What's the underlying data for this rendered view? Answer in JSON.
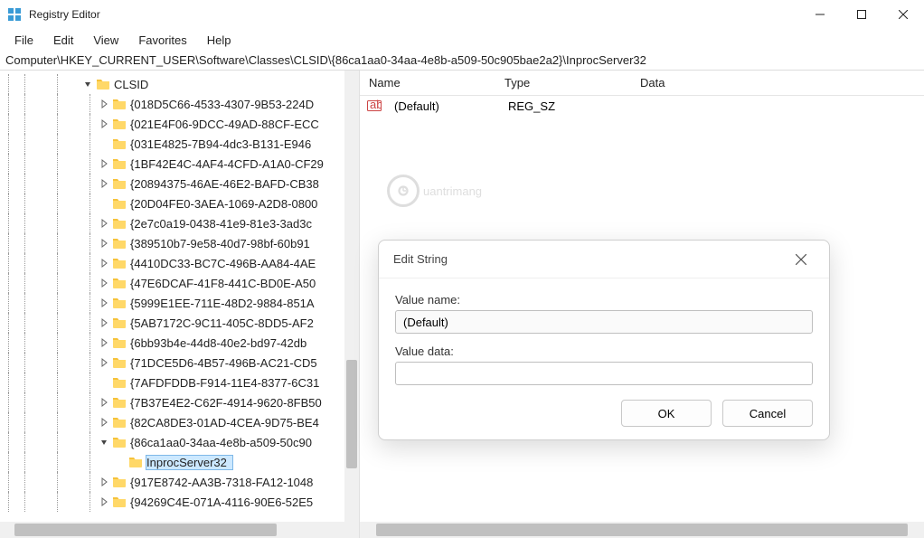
{
  "window": {
    "title": "Registry Editor"
  },
  "menu": {
    "file": "File",
    "edit": "Edit",
    "view": "View",
    "favorites": "Favorites",
    "help": "Help"
  },
  "addressbar": "Computer\\HKEY_CURRENT_USER\\Software\\Classes\\CLSID\\{86ca1aa0-34aa-4e8b-a509-50c905bae2a2}\\InprocServer32",
  "columns": {
    "name": "Name",
    "type": "Type",
    "data": "Data"
  },
  "values": [
    {
      "name": "(Default)",
      "type": "REG_SZ",
      "data": ""
    }
  ],
  "watermark": "uantrimang",
  "tree": {
    "root": "CLSID",
    "items": [
      {
        "label": "{018D5C66-4533-4307-9B53-224D",
        "exp": "closed"
      },
      {
        "label": "{021E4F06-9DCC-49AD-88CF-ECC",
        "exp": "closed"
      },
      {
        "label": "{031E4825-7B94-4dc3-B131-E946",
        "exp": "none"
      },
      {
        "label": "{1BF42E4C-4AF4-4CFD-A1A0-CF29",
        "exp": "closed"
      },
      {
        "label": "{20894375-46AE-46E2-BAFD-CB38",
        "exp": "closed"
      },
      {
        "label": "{20D04FE0-3AEA-1069-A2D8-0800",
        "exp": "none"
      },
      {
        "label": "{2e7c0a19-0438-41e9-81e3-3ad3c",
        "exp": "closed"
      },
      {
        "label": "{389510b7-9e58-40d7-98bf-60b91",
        "exp": "closed"
      },
      {
        "label": "{4410DC33-BC7C-496B-AA84-4AE",
        "exp": "closed"
      },
      {
        "label": "{47E6DCAF-41F8-441C-BD0E-A50",
        "exp": "closed"
      },
      {
        "label": "{5999E1EE-711E-48D2-9884-851A",
        "exp": "closed"
      },
      {
        "label": "{5AB7172C-9C11-405C-8DD5-AF2",
        "exp": "closed"
      },
      {
        "label": "{6bb93b4e-44d8-40e2-bd97-42db",
        "exp": "closed"
      },
      {
        "label": "{71DCE5D6-4B57-496B-AC21-CD5",
        "exp": "closed"
      },
      {
        "label": "{7AFDFDDB-F914-11E4-8377-6C31",
        "exp": "none"
      },
      {
        "label": "{7B37E4E2-C62F-4914-9620-8FB50",
        "exp": "closed"
      },
      {
        "label": "{82CA8DE3-01AD-4CEA-9D75-BE4",
        "exp": "closed"
      },
      {
        "label": "{86ca1aa0-34aa-4e8b-a509-50c90",
        "exp": "open"
      },
      {
        "label": "{917E8742-AA3B-7318-FA12-1048",
        "exp": "closed"
      },
      {
        "label": "{94269C4E-071A-4116-90E6-52E5",
        "exp": "closed"
      }
    ],
    "selected_child": "InprocServer32"
  },
  "dialog": {
    "title": "Edit String",
    "value_name_label": "Value name:",
    "value_name": "(Default)",
    "value_data_label": "Value data:",
    "value_data": "",
    "ok": "OK",
    "cancel": "Cancel"
  }
}
